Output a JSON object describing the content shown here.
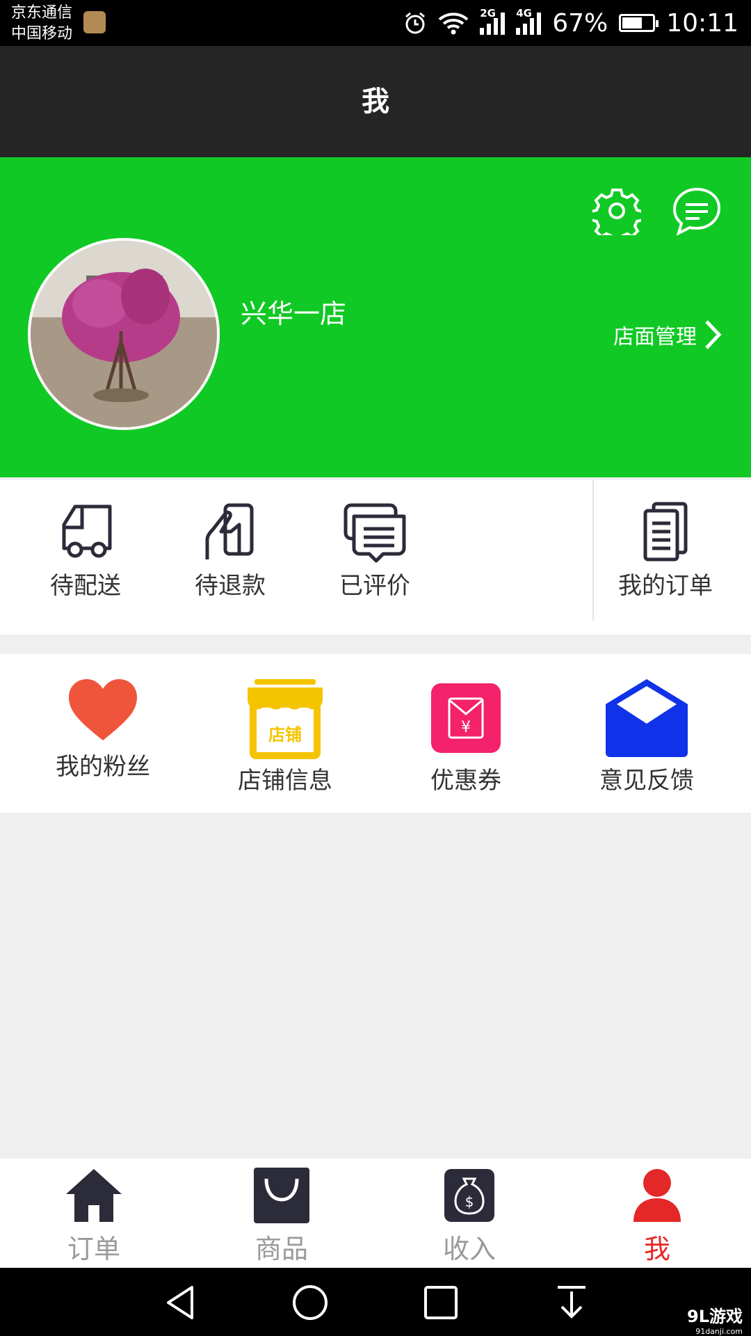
{
  "status_bar": {
    "carrier_1": "京东通信",
    "carrier_2": "中国移动",
    "net_1": "2G",
    "net_2": "4G",
    "battery": "67%",
    "battery_level": 0.67,
    "time": "10:11"
  },
  "header": {
    "title": "我"
  },
  "profile": {
    "store_name": "兴华一店",
    "manage_label": "店面管理",
    "bg_color": "#10c924"
  },
  "orders": {
    "items": [
      {
        "label": "待配送",
        "icon": "truck-icon"
      },
      {
        "label": "待退款",
        "icon": "refund-icon"
      },
      {
        "label": "已评价",
        "icon": "comments-icon"
      }
    ],
    "my_orders_label": "我的订单"
  },
  "services": {
    "items": [
      {
        "label": "我的粉丝",
        "icon": "heart-icon",
        "color": "#ef553b"
      },
      {
        "label": "店铺信息",
        "icon": "shop-icon",
        "color": "#f5c400",
        "icon_text": "店铺"
      },
      {
        "label": "优惠券",
        "icon": "coupon-icon",
        "color": "#f3226b",
        "icon_text": "¥"
      },
      {
        "label": "意见反馈",
        "icon": "mail-icon",
        "color": "#1032e8"
      }
    ]
  },
  "tabs": [
    {
      "label": "订单",
      "icon": "home-icon",
      "active": false
    },
    {
      "label": "商品",
      "icon": "bag-icon",
      "active": false
    },
    {
      "label": "收入",
      "icon": "money-bag-icon",
      "active": false,
      "icon_text": "$"
    },
    {
      "label": "我",
      "icon": "person-icon",
      "active": true
    }
  ],
  "active_color": "#e42727",
  "watermark": {
    "brand": "9L游戏",
    "site": "91danji.com"
  }
}
